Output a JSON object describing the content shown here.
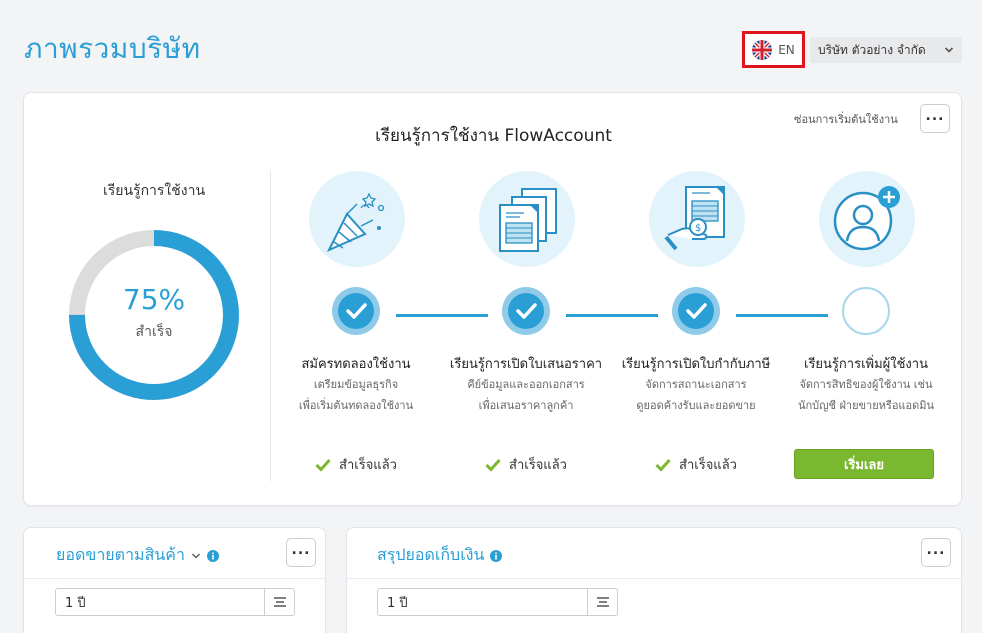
{
  "page": {
    "title": "ภาพรวมบริษัท"
  },
  "header": {
    "language": {
      "label": "EN",
      "icon": "uk-flag-icon"
    },
    "company": {
      "name": "บริษัท ตัวอย่าง จำกัด"
    }
  },
  "onboarding": {
    "hide_label": "ซ่อนการเริ่มต้นใช้งาน",
    "title": "เรียนรู้การใช้งาน FlowAccount",
    "progress": {
      "heading": "เรียนรู้การใช้งาน",
      "percent": 75,
      "percent_label": "75%",
      "sub_label": "สำเร็จ"
    },
    "steps": [
      {
        "title": "สมัครทดลองใช้งาน",
        "desc1": "เตรียมข้อมูลธุรกิจ",
        "desc2": "เพื่อเริ่มต้นทดลองใช้งาน",
        "status": "สำเร็จแล้ว",
        "done": true,
        "icon": "party-popper-icon"
      },
      {
        "title": "เรียนรู้การเปิดใบเสนอราคา",
        "desc1": "คีย์ข้อมูลและออกเอกสาร",
        "desc2": "เพื่อเสนอราคาลูกค้า",
        "status": "สำเร็จแล้ว",
        "done": true,
        "icon": "documents-icon"
      },
      {
        "title": "เรียนรู้การเปิดใบกำกับภาษี",
        "desc1": "จัดการสถานะเอกสาร",
        "desc2": "ดูยอดค้างรับและยอดขาย",
        "status": "สำเร็จแล้ว",
        "done": true,
        "icon": "invoice-payment-icon"
      },
      {
        "title": "เรียนรู้การเพิ่มผู้ใช้งาน",
        "desc1": "จัดการสิทธิของผู้ใช้งาน เช่น",
        "desc2": "นักบัญชี ฝ่ายขายหรือแอดมิน",
        "button": "เริ่มเลย",
        "done": false,
        "icon": "add-user-icon"
      }
    ]
  },
  "sales_by_product": {
    "title": "ยอดขายตามสินค้า",
    "range": "1 ปี"
  },
  "collection_summary": {
    "title": "สรุปยอดเก็บเงิน",
    "range": "1 ปี"
  },
  "colors": {
    "accent": "#2a9fd6",
    "success": "#79b82f",
    "highlight_border": "#e0141e",
    "track": "#dcdcdc"
  }
}
